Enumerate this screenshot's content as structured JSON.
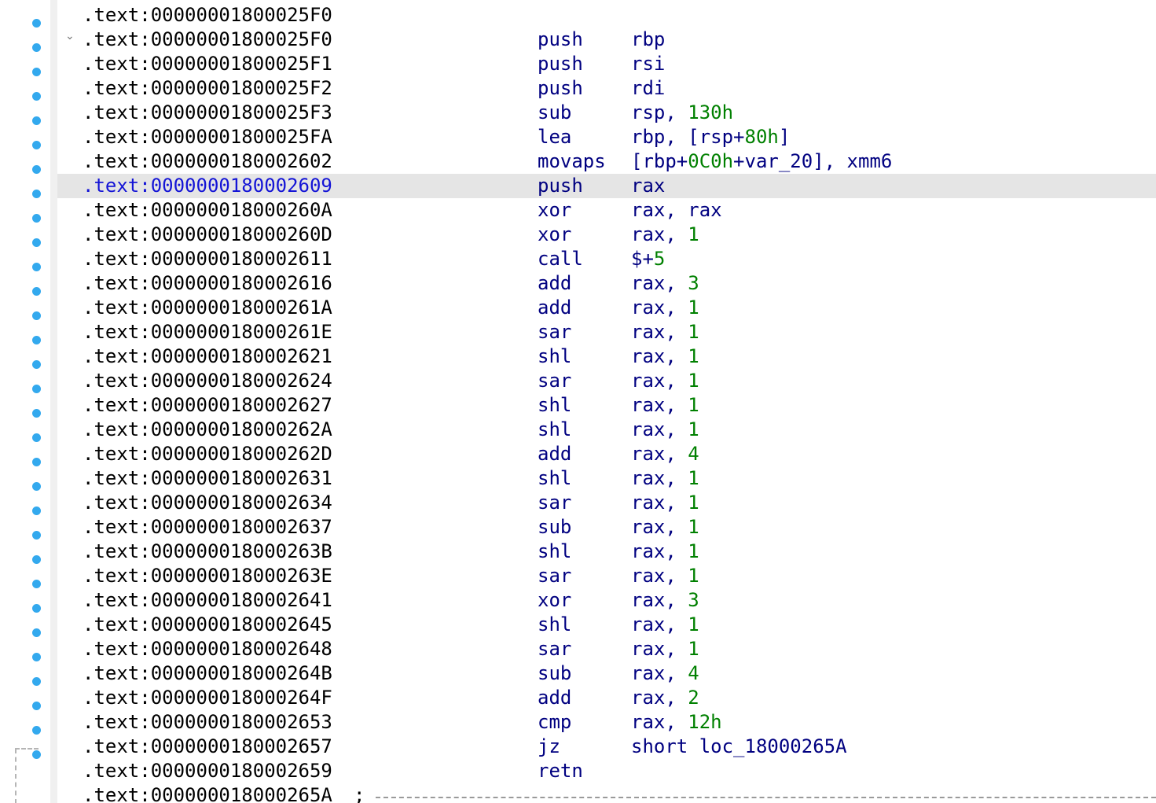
{
  "gutter": {
    "dot_color": "#33a9ee",
    "collapse_icon": "chevron-down-icon"
  },
  "listing": {
    "lines": [
      {
        "addr": ".text:00000001800025F0",
        "mnem": "",
        "ops": []
      },
      {
        "addr": ".text:00000001800025F0",
        "mnem": "push",
        "ops": [
          {
            "t": "rbp"
          }
        ]
      },
      {
        "addr": ".text:00000001800025F1",
        "mnem": "push",
        "ops": [
          {
            "t": "rsi"
          }
        ]
      },
      {
        "addr": ".text:00000001800025F2",
        "mnem": "push",
        "ops": [
          {
            "t": "rdi"
          }
        ]
      },
      {
        "addr": ".text:00000001800025F3",
        "mnem": "sub",
        "ops": [
          {
            "t": "rsp, "
          },
          {
            "t": "130h",
            "n": true
          }
        ]
      },
      {
        "addr": ".text:00000001800025FA",
        "mnem": "lea",
        "ops": [
          {
            "t": "rbp, [rsp+"
          },
          {
            "t": "80h",
            "n": true
          },
          {
            "t": "]"
          }
        ]
      },
      {
        "addr": ".text:0000000180002602",
        "mnem": "movaps",
        "ops": [
          {
            "t": "[rbp+"
          },
          {
            "t": "0C0h",
            "n": true
          },
          {
            "t": "+var_20], xmm6"
          }
        ]
      },
      {
        "addr": ".text:0000000180002609",
        "mnem": "push",
        "ops": [
          {
            "t": "rax"
          }
        ],
        "current": true
      },
      {
        "addr": ".text:000000018000260A",
        "mnem": "xor",
        "ops": [
          {
            "t": "rax, rax"
          }
        ]
      },
      {
        "addr": ".text:000000018000260D",
        "mnem": "xor",
        "ops": [
          {
            "t": "rax, "
          },
          {
            "t": "1",
            "n": true
          }
        ]
      },
      {
        "addr": ".text:0000000180002611",
        "mnem": "call",
        "ops": [
          {
            "t": "$+"
          },
          {
            "t": "5",
            "n": true
          }
        ]
      },
      {
        "addr": ".text:0000000180002616",
        "mnem": "add",
        "ops": [
          {
            "t": "rax, "
          },
          {
            "t": "3",
            "n": true
          }
        ]
      },
      {
        "addr": ".text:000000018000261A",
        "mnem": "add",
        "ops": [
          {
            "t": "rax, "
          },
          {
            "t": "1",
            "n": true
          }
        ]
      },
      {
        "addr": ".text:000000018000261E",
        "mnem": "sar",
        "ops": [
          {
            "t": "rax, "
          },
          {
            "t": "1",
            "n": true
          }
        ]
      },
      {
        "addr": ".text:0000000180002621",
        "mnem": "shl",
        "ops": [
          {
            "t": "rax, "
          },
          {
            "t": "1",
            "n": true
          }
        ]
      },
      {
        "addr": ".text:0000000180002624",
        "mnem": "sar",
        "ops": [
          {
            "t": "rax, "
          },
          {
            "t": "1",
            "n": true
          }
        ]
      },
      {
        "addr": ".text:0000000180002627",
        "mnem": "shl",
        "ops": [
          {
            "t": "rax, "
          },
          {
            "t": "1",
            "n": true
          }
        ]
      },
      {
        "addr": ".text:000000018000262A",
        "mnem": "shl",
        "ops": [
          {
            "t": "rax, "
          },
          {
            "t": "1",
            "n": true
          }
        ]
      },
      {
        "addr": ".text:000000018000262D",
        "mnem": "add",
        "ops": [
          {
            "t": "rax, "
          },
          {
            "t": "4",
            "n": true
          }
        ]
      },
      {
        "addr": ".text:0000000180002631",
        "mnem": "shl",
        "ops": [
          {
            "t": "rax, "
          },
          {
            "t": "1",
            "n": true
          }
        ]
      },
      {
        "addr": ".text:0000000180002634",
        "mnem": "sar",
        "ops": [
          {
            "t": "rax, "
          },
          {
            "t": "1",
            "n": true
          }
        ]
      },
      {
        "addr": ".text:0000000180002637",
        "mnem": "sub",
        "ops": [
          {
            "t": "rax, "
          },
          {
            "t": "1",
            "n": true
          }
        ]
      },
      {
        "addr": ".text:000000018000263B",
        "mnem": "shl",
        "ops": [
          {
            "t": "rax, "
          },
          {
            "t": "1",
            "n": true
          }
        ]
      },
      {
        "addr": ".text:000000018000263E",
        "mnem": "sar",
        "ops": [
          {
            "t": "rax, "
          },
          {
            "t": "1",
            "n": true
          }
        ]
      },
      {
        "addr": ".text:0000000180002641",
        "mnem": "xor",
        "ops": [
          {
            "t": "rax, "
          },
          {
            "t": "3",
            "n": true
          }
        ]
      },
      {
        "addr": ".text:0000000180002645",
        "mnem": "shl",
        "ops": [
          {
            "t": "rax, "
          },
          {
            "t": "1",
            "n": true
          }
        ]
      },
      {
        "addr": ".text:0000000180002648",
        "mnem": "sar",
        "ops": [
          {
            "t": "rax, "
          },
          {
            "t": "1",
            "n": true
          }
        ]
      },
      {
        "addr": ".text:000000018000264B",
        "mnem": "sub",
        "ops": [
          {
            "t": "rax, "
          },
          {
            "t": "4",
            "n": true
          }
        ]
      },
      {
        "addr": ".text:000000018000264F",
        "mnem": "add",
        "ops": [
          {
            "t": "rax, "
          },
          {
            "t": "2",
            "n": true
          }
        ]
      },
      {
        "addr": ".text:0000000180002653",
        "mnem": "cmp",
        "ops": [
          {
            "t": "rax, "
          },
          {
            "t": "12h",
            "n": true
          }
        ]
      },
      {
        "addr": ".text:0000000180002657",
        "mnem": "jz",
        "ops": [
          {
            "t": "short loc_18000265A"
          }
        ]
      },
      {
        "addr": ".text:0000000180002659",
        "mnem": "retn",
        "ops": []
      },
      {
        "addr": ".text:000000018000265A",
        "mnem": "",
        "ops": [],
        "separator": ";"
      }
    ]
  }
}
